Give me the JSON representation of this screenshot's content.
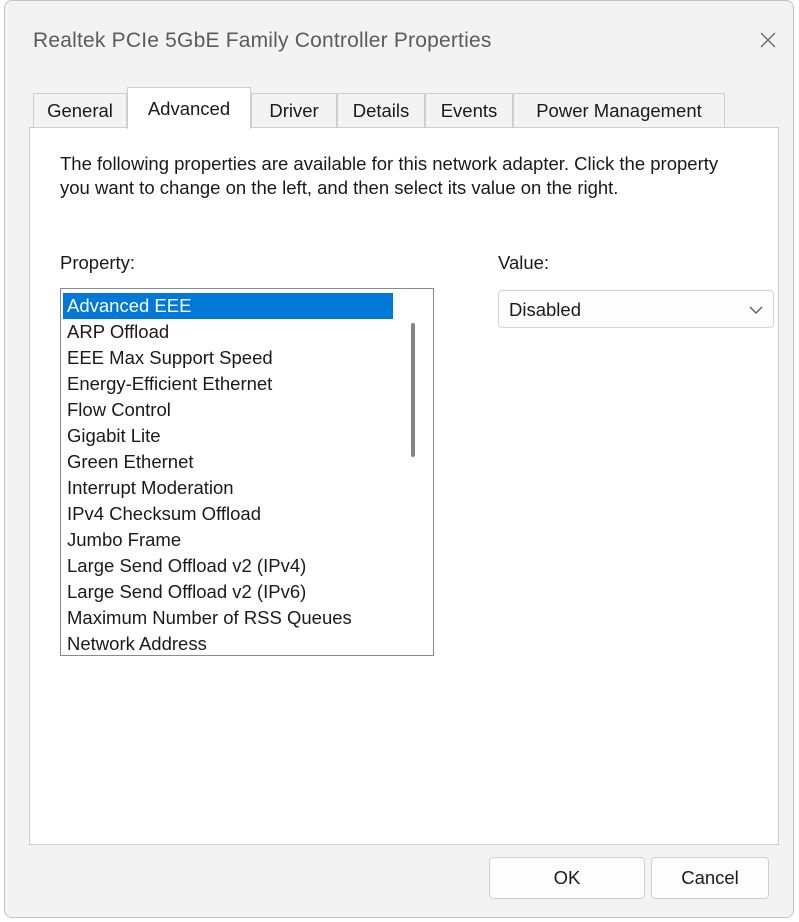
{
  "window": {
    "title": "Realtek PCIe 5GbE Family Controller Properties"
  },
  "tabs": [
    {
      "label": "General"
    },
    {
      "label": "Advanced",
      "active": true
    },
    {
      "label": "Driver"
    },
    {
      "label": "Details"
    },
    {
      "label": "Events"
    },
    {
      "label": "Power Management"
    }
  ],
  "advanced": {
    "description": "The following properties are available for this network adapter. Click the property you want to change on the left, and then select its value on the right.",
    "property_label": "Property:",
    "value_label": "Value:",
    "properties": [
      "Advanced EEE",
      "ARP Offload",
      "EEE Max Support Speed",
      "Energy-Efficient Ethernet",
      "Flow Control",
      "Gigabit Lite",
      "Green Ethernet",
      "Interrupt Moderation",
      "IPv4 Checksum Offload",
      "Jumbo Frame",
      "Large Send Offload v2 (IPv4)",
      "Large Send Offload v2 (IPv6)",
      "Maximum Number of RSS Queues",
      "Network Address"
    ],
    "selected_property": "Advanced EEE",
    "value": "Disabled"
  },
  "buttons": {
    "ok": "OK",
    "cancel": "Cancel"
  },
  "colors": {
    "selection": "#0078d7",
    "window_bg": "#f3f3f3",
    "panel_bg": "#ffffff"
  },
  "icons": {
    "close": "close-icon",
    "dropdown": "chevron-down-icon"
  }
}
